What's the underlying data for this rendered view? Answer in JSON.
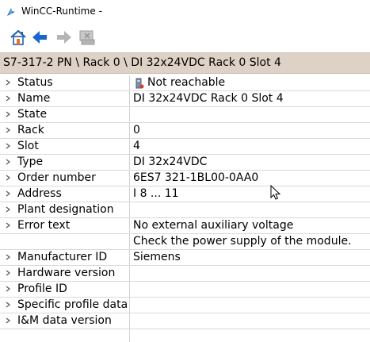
{
  "window": {
    "title": "WinCC-Runtime -"
  },
  "toolbar": {
    "buttons": [
      {
        "name": "home-button",
        "icon": "home-icon",
        "enabled": true
      },
      {
        "name": "back-button",
        "icon": "arrow-left-icon",
        "enabled": true
      },
      {
        "name": "forward-button",
        "icon": "arrow-right-icon",
        "enabled": false
      },
      {
        "name": "module-button",
        "icon": "module-icon",
        "enabled": false
      }
    ]
  },
  "breadcrumb": {
    "text": "S7-317-2 PN \\ Rack 0 \\ DI 32x24VDC Rack 0 Slot 4"
  },
  "properties": [
    {
      "name": "Status",
      "value": "Not reachable",
      "icon": "not-reachable-icon"
    },
    {
      "name": "Name",
      "value": "DI 32x24VDC Rack 0 Slot 4"
    },
    {
      "name": "State",
      "value": ""
    },
    {
      "name": "Rack",
      "value": "0"
    },
    {
      "name": "Slot",
      "value": "4"
    },
    {
      "name": "Type",
      "value": "DI 32x24VDC"
    },
    {
      "name": "Order number",
      "value": "6ES7 321-1BL00-0AA0"
    },
    {
      "name": "Address",
      "value": "I 8 ... 11"
    },
    {
      "name": "Plant designation",
      "value": ""
    },
    {
      "name": "Error text",
      "value": "No external auxiliary voltage"
    },
    {
      "name": "",
      "value": "Check the power supply of the module."
    },
    {
      "name": "Manufacturer ID",
      "value": "Siemens"
    },
    {
      "name": "Hardware version",
      "value": ""
    },
    {
      "name": "Profile ID",
      "value": ""
    },
    {
      "name": "Specific profile data",
      "value": ""
    },
    {
      "name": "I&M data version",
      "value": ""
    },
    {
      "name": "",
      "value": ""
    }
  ],
  "colors": {
    "breadcrumb_bg": "#ddd2c5",
    "home_icon": "#1f5fb0",
    "back_arrow": "#1a66d0",
    "disabled_icon": "#b4b4b4",
    "grid_line": "#d9d9d9"
  }
}
